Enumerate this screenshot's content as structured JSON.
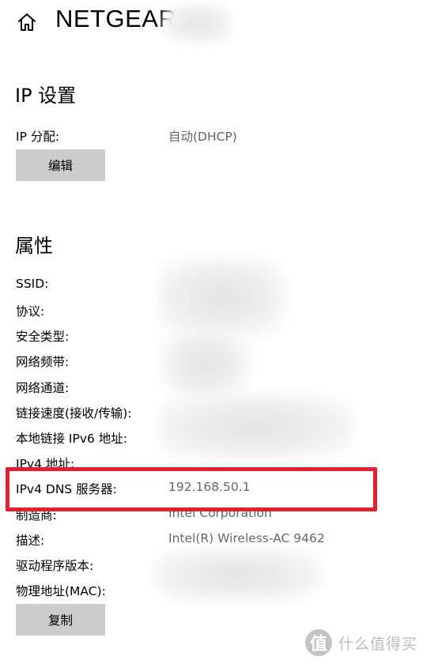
{
  "header": {
    "title": "NETGEAR",
    "home_icon": "home-icon"
  },
  "ip_settings": {
    "heading": "IP 设置",
    "assignment_label": "IP 分配:",
    "assignment_value": "自动(DHCP)",
    "edit_button": "编辑"
  },
  "properties": {
    "heading": "属性",
    "rows": [
      {
        "label": "SSID:",
        "value": ""
      },
      {
        "label": "协议:",
        "value": ""
      },
      {
        "label": "安全类型:",
        "value": ""
      },
      {
        "label": "网络频带:",
        "value": ""
      },
      {
        "label": "网络通道:",
        "value": ""
      },
      {
        "label": "链接速度(接收/传输):",
        "value": ""
      },
      {
        "label": "本地链接 IPv6 地址:",
        "value": ""
      },
      {
        "label": "IPv4 地址:",
        "value": ""
      },
      {
        "label": "IPv4 DNS 服务器:",
        "value": "192.168.50.1"
      },
      {
        "label": "制造商:",
        "value": "Intel Corporation"
      },
      {
        "label": "描述:",
        "value": "Intel(R) Wireless-AC 9462"
      },
      {
        "label": "驱动程序版本:",
        "value": ""
      },
      {
        "label": "物理地址(MAC):",
        "value": ""
      }
    ],
    "copy_button": "复制"
  },
  "highlight": {
    "color": "#e3202f"
  },
  "watermark": {
    "logo_char": "值",
    "text": "什么值得买"
  }
}
